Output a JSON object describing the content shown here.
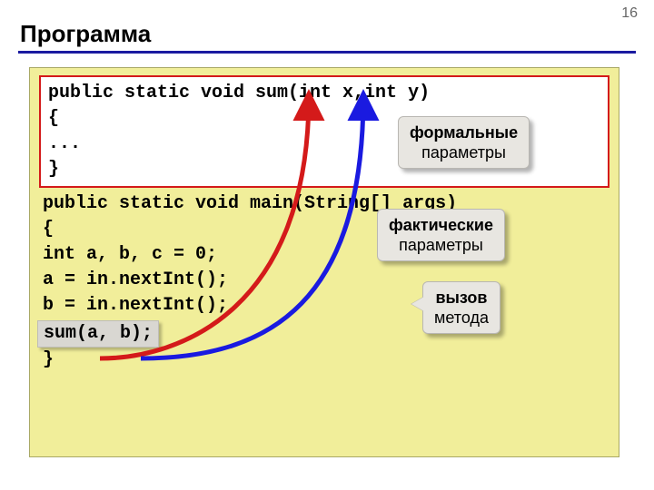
{
  "page_number": "16",
  "title": "Программа",
  "code": {
    "sum_sig": "public static void sum(int x,int y)",
    "brace_open": "{",
    "ellipsis": " ...",
    "brace_close": "}",
    "main_sig": "public static void main(String[] args)",
    "brace_open2": "{",
    "decl": " int a, b, c = 0;",
    "read_a": " a = in.nextInt();",
    "read_b": " b = in.nextInt();",
    "call": "sum(a,  b);",
    "brace_close2": "}"
  },
  "callouts": {
    "formal_bold": "формальные",
    "formal_plain": "параметры",
    "actual_bold": "фактические",
    "actual_plain": "параметры",
    "call_bold": "вызов",
    "call_plain": "метода"
  }
}
